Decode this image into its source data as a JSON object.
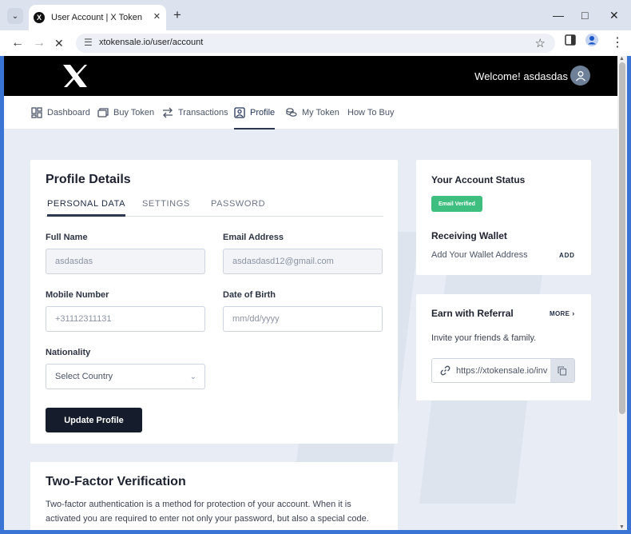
{
  "browser": {
    "tab_title": "User Account | X Token",
    "url": "xtokensale.io/user/account"
  },
  "header": {
    "logo_text": "X",
    "welcome": "Welcome! asdasdas"
  },
  "nav": {
    "items": [
      {
        "label": "Dashboard",
        "icon": "dashboard-icon"
      },
      {
        "label": "Buy Token",
        "icon": "wallet-icon"
      },
      {
        "label": "Transactions",
        "icon": "transfer-icon"
      },
      {
        "label": "Profile",
        "icon": "profile-icon",
        "active": true
      },
      {
        "label": "My Token",
        "icon": "coins-icon"
      },
      {
        "label": "How To Buy"
      }
    ]
  },
  "profile": {
    "title": "Profile Details",
    "tabs": [
      "PERSONAL DATA",
      "SETTINGS",
      "PASSWORD"
    ],
    "active_tab": "PERSONAL DATA",
    "fields": {
      "full_name": {
        "label": "Full Name",
        "value": "asdasdas"
      },
      "email": {
        "label": "Email Address",
        "value": "asdasdasd12@gmail.com"
      },
      "mobile": {
        "label": "Mobile Number",
        "value": "+31112311131"
      },
      "dob": {
        "label": "Date of Birth",
        "placeholder": "mm/dd/yyyy"
      },
      "nationality": {
        "label": "Nationality",
        "selected": "Select Country"
      }
    },
    "update_button": "Update Profile"
  },
  "account_status": {
    "title": "Your Account Status",
    "badge": "Email Verified",
    "wallet_title": "Receiving Wallet",
    "wallet_prompt": "Add Your Wallet Address",
    "add_label": "ADD"
  },
  "referral": {
    "title": "Earn with Referral",
    "more_label": "MORE",
    "subtitle": "Invite your friends & family.",
    "link": "https://xtokensale.io/invite?ref=asdasdas"
  },
  "two_factor": {
    "title": "Two-Factor Verification",
    "description": "Two-factor authentication is a method for protection of your account. When it is activated you are required to enter not only your password, but also a special code."
  },
  "colors": {
    "header_bg": "#000000",
    "page_bg": "#e8edf5",
    "badge_green": "#3fbf7f",
    "button_dark": "#151c2b",
    "browser_frame": "#3a75d6"
  }
}
